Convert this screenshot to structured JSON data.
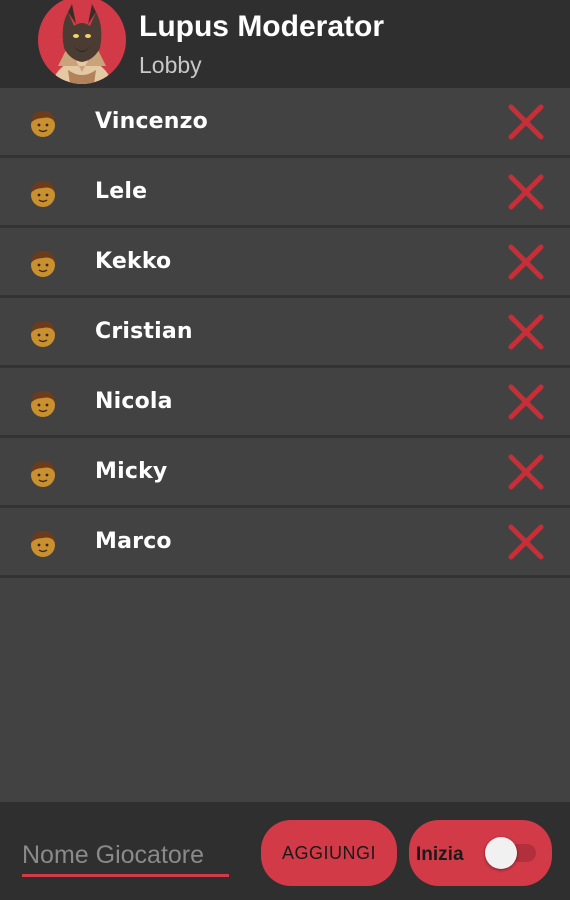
{
  "header": {
    "title": "Lupus Moderator",
    "subtitle": "Lobby",
    "avatar_icon": "wolf-character-avatar"
  },
  "players": [
    {
      "name": "Vincenzo",
      "icon": "person-emoji-icon",
      "remove_icon": "close-icon"
    },
    {
      "name": "Lele",
      "icon": "person-emoji-icon",
      "remove_icon": "close-icon"
    },
    {
      "name": "Kekko",
      "icon": "person-emoji-icon",
      "remove_icon": "close-icon"
    },
    {
      "name": "Cristian",
      "icon": "person-emoji-icon",
      "remove_icon": "close-icon"
    },
    {
      "name": "Nicola",
      "icon": "person-emoji-icon",
      "remove_icon": "close-icon"
    },
    {
      "name": "Micky",
      "icon": "person-emoji-icon",
      "remove_icon": "close-icon"
    },
    {
      "name": "Marco",
      "icon": "person-emoji-icon",
      "remove_icon": "close-icon"
    }
  ],
  "bottom_bar": {
    "name_input": {
      "value": "",
      "placeholder": "Nome Giocatore"
    },
    "add_label": "AGGIUNGI",
    "start_label": "Inizia",
    "start_switch_on": false
  },
  "colors": {
    "accent": "#d33a48",
    "background": "#424242",
    "bar": "#2f2f2f",
    "remove_icon": "#c62f37"
  }
}
